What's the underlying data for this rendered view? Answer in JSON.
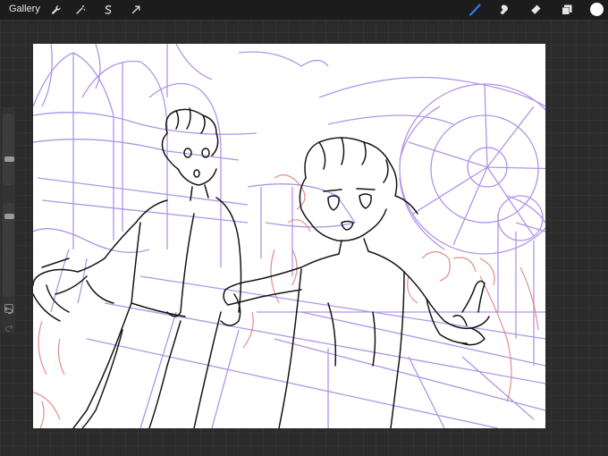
{
  "toolbar": {
    "gallery_label": "Gallery",
    "left_tools": [
      "wrench-icon",
      "magic-wand-icon",
      "selection-icon",
      "transform-arrow-icon"
    ],
    "right_tools": [
      "brush-icon",
      "smudge-icon",
      "eraser-icon",
      "layers-icon"
    ],
    "active_tool": "brush-icon",
    "accent_color": "#2f7cf6",
    "current_color": "#ffffff"
  },
  "sidebar": {
    "brush_size_level": 0.35,
    "opacity_level": 0.9,
    "undo_icon": "undo-icon",
    "redo_icon": "redo-icon"
  },
  "canvas": {
    "sketch_colors": {
      "line": "#151515",
      "structure": "#9b78e0",
      "accents": "#e0736b"
    }
  }
}
